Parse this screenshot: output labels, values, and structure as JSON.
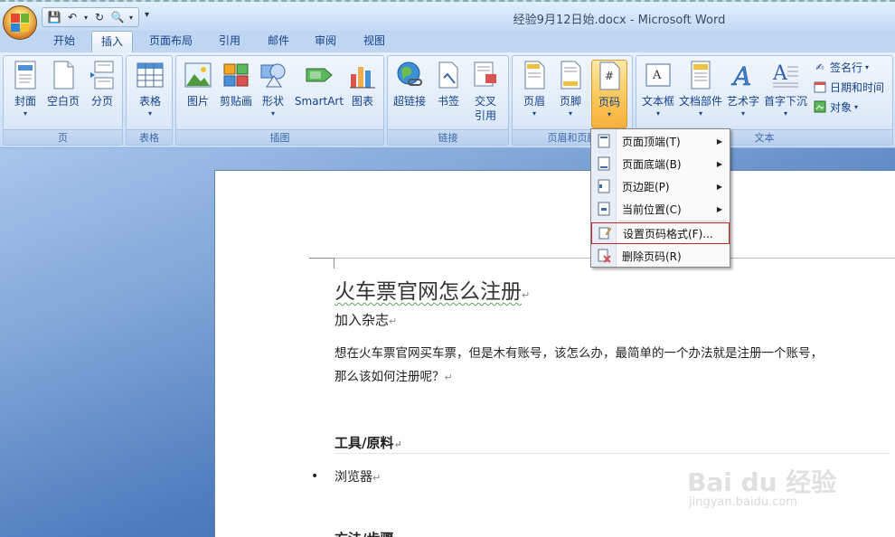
{
  "window": {
    "title": "经验9月12日始.docx - Microsoft Word"
  },
  "quick_access": {
    "icons": [
      "save-icon",
      "undo-icon",
      "redo-icon",
      "print-preview-icon"
    ],
    "more": "▾"
  },
  "tabs": [
    "开始",
    "插入",
    "页面布局",
    "引用",
    "邮件",
    "审阅",
    "视图"
  ],
  "active_tab": "插入",
  "ribbon": {
    "groups": {
      "pages": {
        "label": "页",
        "buttons": [
          "封面",
          "空白页",
          "分页"
        ]
      },
      "tables": {
        "label": "表格",
        "buttons": [
          "表格"
        ]
      },
      "illustrations": {
        "label": "插图",
        "buttons": [
          "图片",
          "剪贴画",
          "形状",
          "SmartArt",
          "图表"
        ]
      },
      "links": {
        "label": "链接",
        "buttons": [
          "超链接",
          "书签",
          "交叉引用"
        ]
      },
      "header_footer": {
        "label": "页眉和页脚",
        "buttons": [
          "页眉",
          "页脚",
          "页码"
        ]
      },
      "text": {
        "label": "文本",
        "buttons": [
          "文本框",
          "文档部件",
          "艺术字",
          "首字下沉"
        ],
        "small": [
          "签名行",
          "日期和时间",
          "对象"
        ]
      }
    }
  },
  "dropdown": {
    "items": [
      {
        "label": "页面顶端(T)",
        "has_submenu": true
      },
      {
        "label": "页面底端(B)",
        "has_submenu": true
      },
      {
        "label": "页边距(P)",
        "has_submenu": true
      },
      {
        "label": "当前位置(C)",
        "has_submenu": true
      },
      {
        "label": "设置页码格式(F)...",
        "has_submenu": false,
        "highlighted": true
      },
      {
        "label": "删除页码(R)",
        "has_submenu": false
      }
    ]
  },
  "document": {
    "title": "火车票官网怎么注册",
    "subtitle": "加入杂志",
    "para_line1": "想在火车票官网买车票，但是木有账号，该怎么办，最简单的一个办法就是注册一个账号，",
    "para_line2": "那么该如何注册呢？",
    "section": "工具/原料",
    "bullet": "浏览器",
    "next_section": "方法/步骤",
    "mark": "↵"
  },
  "watermark": {
    "text": "Bai du 经验",
    "url": "jingyan.baidu.com"
  },
  "colors": {
    "ribbon_text": "#15428b",
    "highlight": "#f9c75a",
    "outline_red": "#c62828"
  }
}
